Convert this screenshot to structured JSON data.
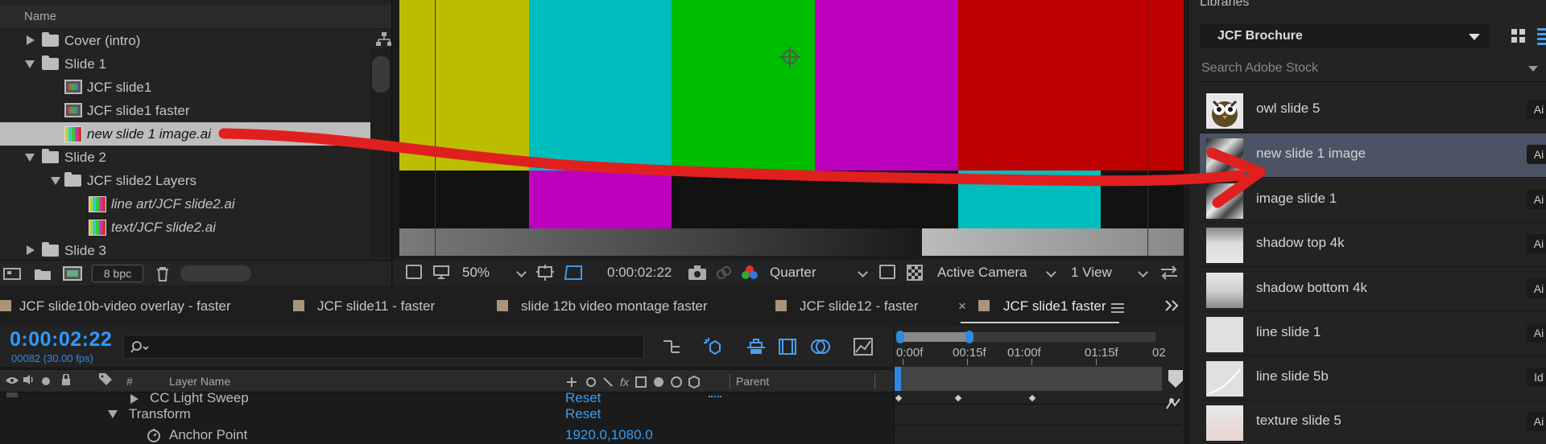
{
  "project": {
    "column_name": "Name",
    "tree": [
      {
        "label": "Cover (intro)",
        "type": "folder",
        "expanded": false,
        "italic": false
      },
      {
        "label": "Slide 1",
        "type": "folder",
        "expanded": true,
        "italic": false
      },
      {
        "label": "JCF slide1",
        "type": "comp",
        "italic": false
      },
      {
        "label": "JCF slide1 faster",
        "type": "comp",
        "italic": false
      },
      {
        "label": "new slide 1 image.ai",
        "type": "ai",
        "italic": true,
        "selected": true
      },
      {
        "label": "Slide 2",
        "type": "folder",
        "expanded": true,
        "italic": false
      },
      {
        "label": "JCF slide2 Layers",
        "type": "folder",
        "expanded": true,
        "italic": false
      },
      {
        "label": "line art/JCF slide2.ai",
        "type": "ai",
        "italic": true
      },
      {
        "label": "text/JCF slide2.ai",
        "type": "ai",
        "italic": true
      },
      {
        "label": "Slide 3",
        "type": "folder",
        "expanded": false,
        "italic": false
      }
    ],
    "bpc": "8 bpc"
  },
  "viewer": {
    "zoom": "50%",
    "timecode": "0:00:02:22",
    "resolution": "Quarter",
    "camera": "Active Camera",
    "views": "1 View",
    "bar_colors_top": [
      "#bdbd00",
      "#00bdbd",
      "#00bd00",
      "#bd00bd",
      "#bd0000"
    ],
    "bar_colors_mid": [
      "#121212",
      "#bd00bd",
      "#121212",
      "#00bdbd",
      "#121212"
    ]
  },
  "timeline": {
    "tabs": [
      {
        "label": "JCF slide10b-video overlay - faster"
      },
      {
        "label": "JCF slide11 - faster"
      },
      {
        "label": "slide 12b video montage faster"
      },
      {
        "label": "JCF slide12 - faster"
      },
      {
        "label": "JCF slide1 faster",
        "active": true
      }
    ],
    "timecode": "0:00:02:22",
    "frames": "00082 (30.00 fps)",
    "layer_header": {
      "hash": "#",
      "layer_name": "Layer Name",
      "parent": "Parent"
    },
    "rows": [
      {
        "label": "CC Light Sweep",
        "value": "Reset"
      },
      {
        "label": "Transform",
        "value": "Reset"
      },
      {
        "label": "Anchor Point",
        "value": "1920.0,1080.0"
      }
    ],
    "ruler": [
      "0:00f",
      "00:15f",
      "01:00f",
      "01:15f",
      "02"
    ]
  },
  "libraries": {
    "title": "Libraries",
    "selected_library": "JCF Brochure",
    "search_placeholder": "Search Adobe Stock",
    "items": [
      {
        "name": "owl slide 5",
        "badge": "Ai"
      },
      {
        "name": "new slide 1 image",
        "badge": "Ai",
        "selected": true
      },
      {
        "name": "image slide 1",
        "badge": "Ai"
      },
      {
        "name": "shadow top 4k",
        "badge": "Ai"
      },
      {
        "name": "shadow bottom 4k",
        "badge": "Ai"
      },
      {
        "name": "line slide 1",
        "badge": "Ai"
      },
      {
        "name": "line slide 5b",
        "badge": "Id"
      },
      {
        "name": "texture slide 5",
        "badge": "Ai"
      }
    ]
  },
  "colors": {
    "accent_blue": "#2e9aff",
    "annotation_red": "#e0201f",
    "selected_library_row": "#4b5364"
  }
}
